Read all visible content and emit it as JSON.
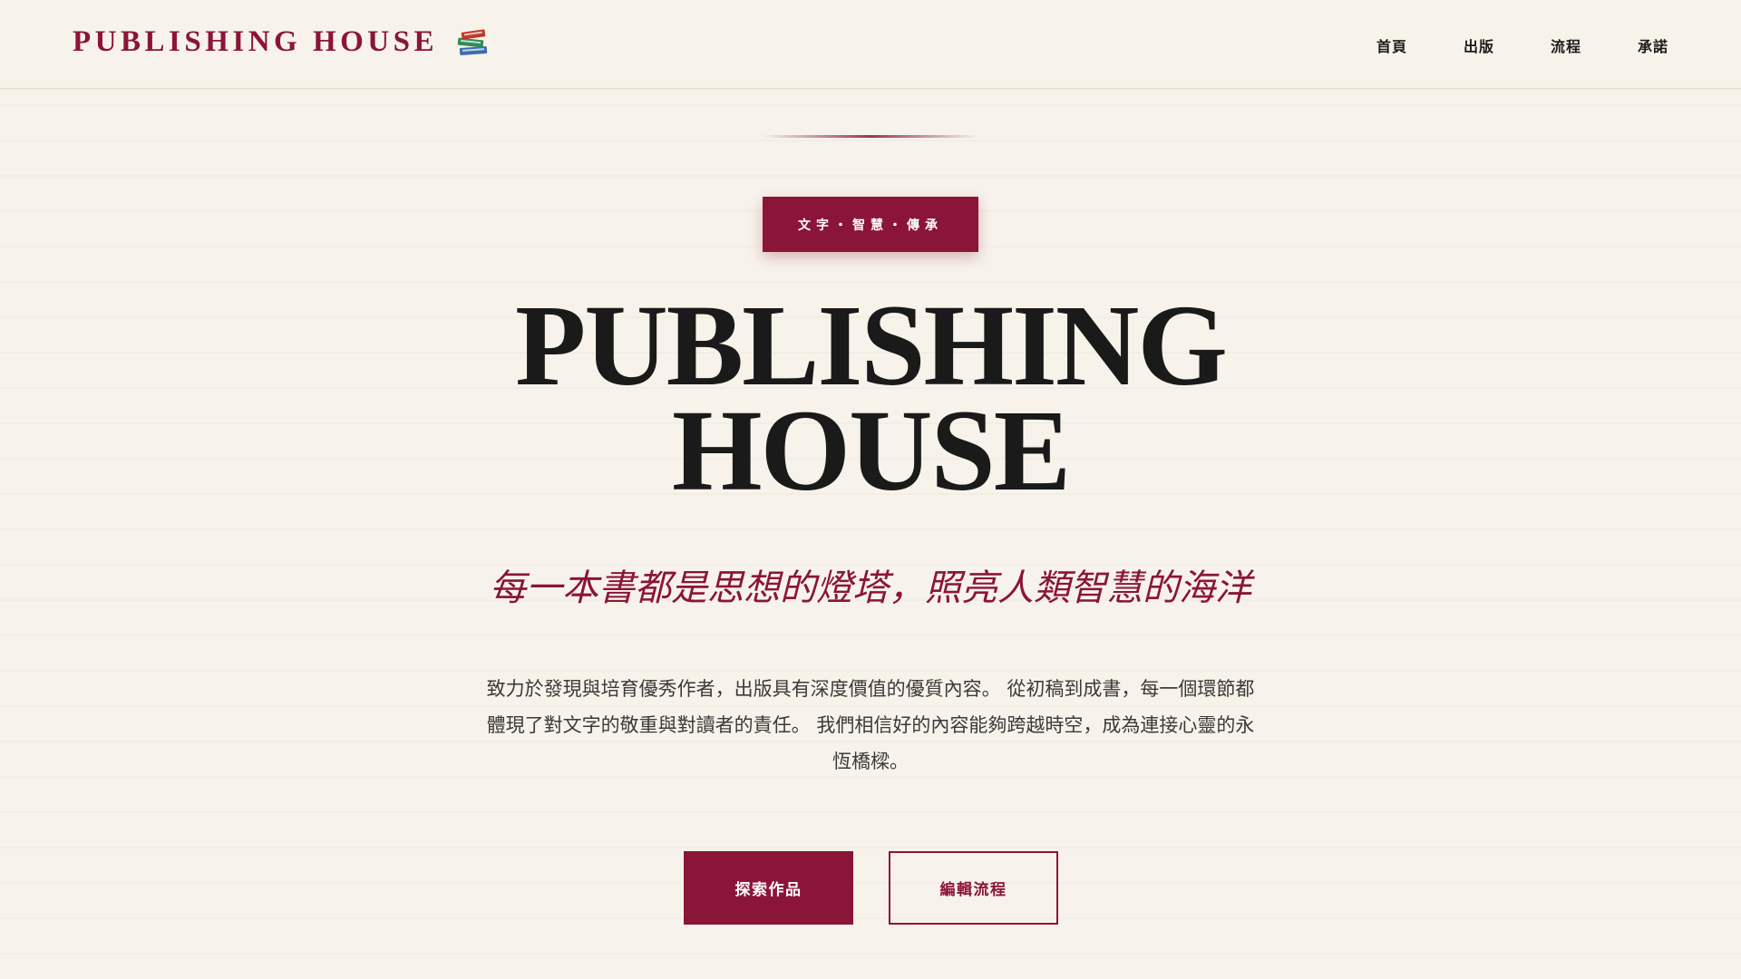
{
  "header": {
    "logo_text": "PUBLISHING HOUSE",
    "logo_icon": "books-icon",
    "nav": [
      {
        "label": "首頁"
      },
      {
        "label": "出版"
      },
      {
        "label": "流程"
      },
      {
        "label": "承諾"
      }
    ]
  },
  "hero": {
    "badge": "文字・智慧・傳承",
    "title_line1": "PUBLISHING",
    "title_line2": "HOUSE",
    "subtitle": "每一本書都是思想的燈塔，照亮人類智慧的海洋",
    "description": "致力於發現與培育優秀作者，出版具有深度價值的優質內容。 從初稿到成書，每一個環節都體現了對文字的敬重與對讀者的責任。 我們相信好的內容能夠跨越時空，成為連接心靈的永恆橋樑。",
    "primary_button": "探索作品",
    "secondary_button": "編輯流程"
  },
  "colors": {
    "accent": "#8b1538",
    "background": "#f7f3ea",
    "text": "#1a1a1a"
  }
}
